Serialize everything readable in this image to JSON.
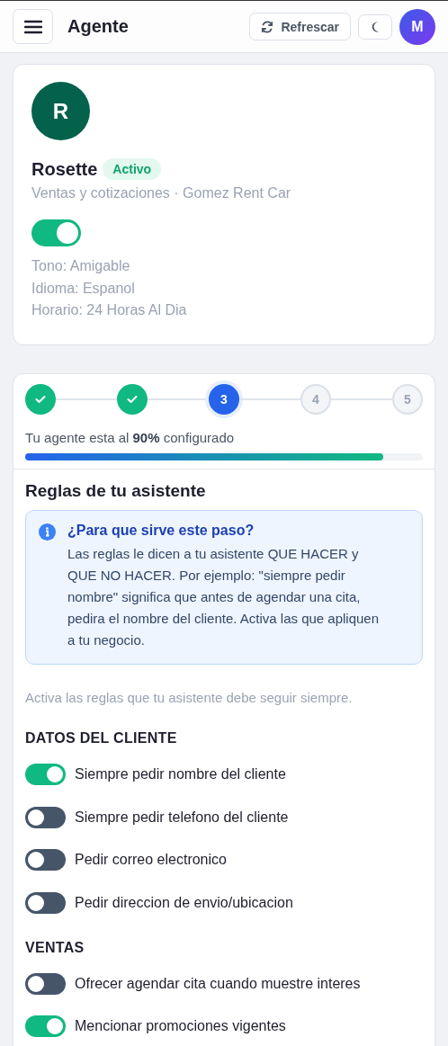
{
  "header": {
    "title": "Agente",
    "refresh_label": "Refrescar",
    "avatar_initial": "M"
  },
  "agent": {
    "initial": "R",
    "name": "Rosette",
    "status": "Activo",
    "subtitle": "Ventas y cotizaciones · Gomez Rent Car",
    "on": true,
    "details": [
      "Tono: Amigable",
      "Idioma: Espanol",
      "Horario: 24 Horas Al Dia"
    ]
  },
  "wizard": {
    "steps": [
      {
        "done": true,
        "selected": false
      },
      {
        "done": true,
        "selected": false
      },
      {
        "done": false,
        "selected": true,
        "label": "3"
      },
      {
        "done": false,
        "selected": false,
        "label": "4"
      },
      {
        "done": false,
        "selected": false,
        "label": "5"
      }
    ],
    "progress_text": "Tu agente esta al **90%** configurado",
    "level": 0.9,
    "section_title": "Reglas de tu asistente",
    "info": {
      "title": "¿Para que sirve este paso?",
      "body": "Las reglas le dicen a tu asistente QUE HACER y QUE NO HACER. Por ejemplo: \"siempre pedir nombre\" significa que antes de agendar una cita, pedira el nombre del cliente. Activa las que apliquen a tu negocio."
    },
    "hint": "Activa las reglas que tu asistente debe seguir siempre.",
    "groups": [
      {
        "title": "DATOS DEL CLIENTE",
        "rules": [
          {
            "label": "Siempre pedir nombre del cliente",
            "on": true
          },
          {
            "label": "Siempre pedir telefono del cliente",
            "on": false
          },
          {
            "label": "Pedir correo electronico",
            "on": false
          },
          {
            "label": "Pedir direccion de envio/ubicacion",
            "on": false
          }
        ]
      },
      {
        "title": "VENTAS",
        "rules": [
          {
            "label": "Ofrecer agendar cita cuando muestre interes",
            "on": false
          },
          {
            "label": "Mencionar promociones vigentes",
            "on": true
          }
        ]
      }
    ]
  }
}
